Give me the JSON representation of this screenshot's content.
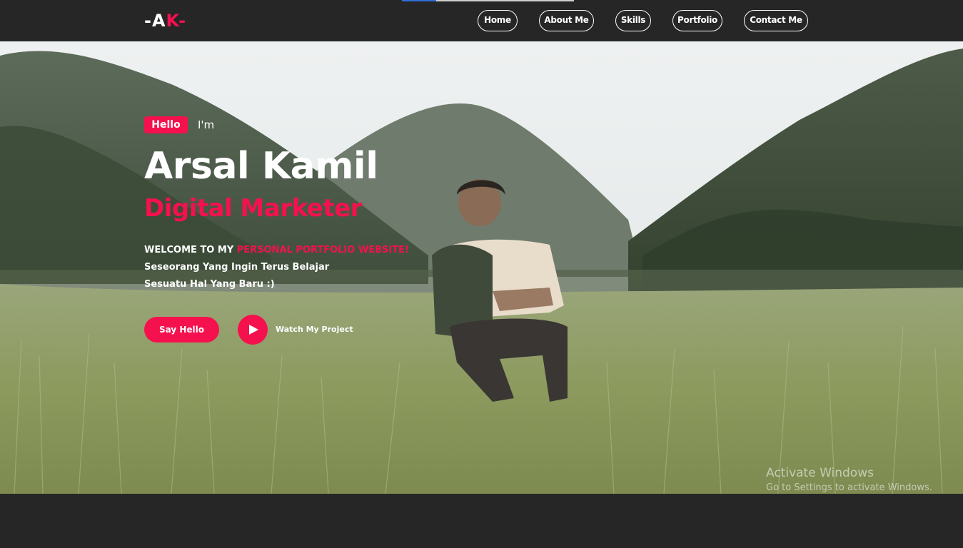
{
  "navbar": {
    "logo": {
      "dash_left": "-",
      "a": "A",
      "k": "K",
      "dash_right": "-"
    },
    "links": [
      {
        "label": "Home"
      },
      {
        "label": "About Me"
      },
      {
        "label": "Skills"
      },
      {
        "label": "Portfolio"
      },
      {
        "label": "Contact Me"
      }
    ],
    "scroll_progress_fraction": 0.2
  },
  "hero": {
    "hello_badge": "Hello",
    "im_text": "I'm",
    "name": "Arsal Kamil",
    "role": "Digital Marketer",
    "welcome_prefix": "WELCOME TO MY ",
    "welcome_highlight": "PERSONAL PORTFOLIO WEBSITE!",
    "tagline_line1": "Seseorang Yang Ingin Terus Belajar",
    "tagline_line2": "Sesuatu Hal Yang Baru :)",
    "say_hello_button": "Say Hello",
    "watch_project_label": "Watch My Project",
    "play_icon": "play-icon"
  },
  "os_watermark": {
    "title": "Activate Windows",
    "subtitle": "Go to Settings to activate Windows."
  },
  "colors": {
    "accent": "#f5114d",
    "navbar_bg": "#262626",
    "text": "#ffffff"
  }
}
